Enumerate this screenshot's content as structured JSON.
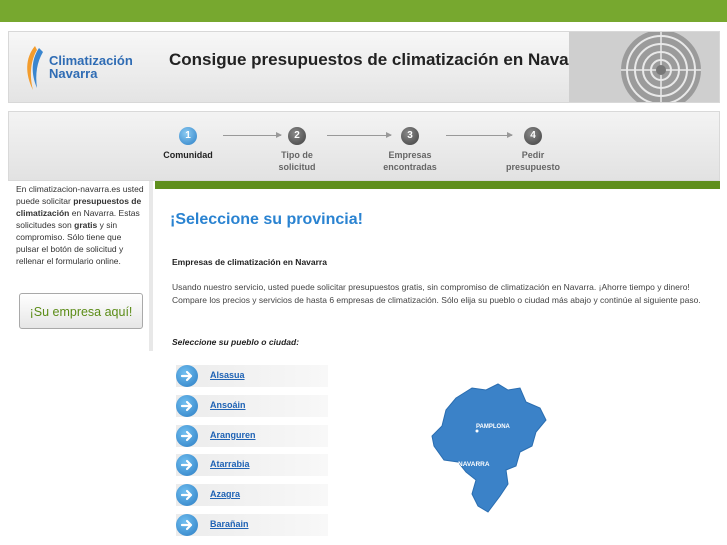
{
  "brand": {
    "line1": "Climatización",
    "line2": "Navarra"
  },
  "header": {
    "title": "Consigue presupuestos de climatización en Navarra"
  },
  "steps": [
    {
      "number": "1",
      "label_line1": "Comunidad",
      "label_line2": ""
    },
    {
      "number": "2",
      "label_line1": "Tipo de",
      "label_line2": "solicitud"
    },
    {
      "number": "3",
      "label_line1": "Empresas",
      "label_line2": "encontradas"
    },
    {
      "number": "4",
      "label_line1": "Pedir",
      "label_line2": "presupuesto"
    }
  ],
  "sidebar": {
    "intro": "En climatizacion-navarra.es usted puede solicitar",
    "bold1": "presupuestos de climatización",
    "mid": " en Navarra. Estas solicitudes son ",
    "bold2": "gratis",
    "end": " y sin compromiso. Sólo tiene que pulsar el botón de solicitud y rellenar el formulario online.",
    "promo_label": "¡Su empresa aquí!"
  },
  "main": {
    "heading": "¡Seleccione su provincia!",
    "subheading": "Empresas de climatización en Navarra",
    "description": "Usando nuestro servicio, usted puede solicitar presupuestos gratis, sin compromiso de climatización en Navarra. ¡Ahorre tiempo y dinero! Compare los precios y servicios de hasta  6 empresas de climatización. Sólo elija su pueblo o ciudad más abajo y continúe al siguiente paso.",
    "select_prompt": "Seleccione su pueblo o ciudad:"
  },
  "towns": [
    "Alsasua",
    "Ansoáin",
    "Aranguren",
    "Atarrabia",
    "Azagra",
    "Barañain"
  ],
  "map": {
    "label_city": "PAMPLONA",
    "label_region": "NAVARRA"
  },
  "colors": {
    "accent_green": "#77a82f",
    "link_blue": "#1f63b5",
    "heading_blue": "#2a83d1"
  }
}
